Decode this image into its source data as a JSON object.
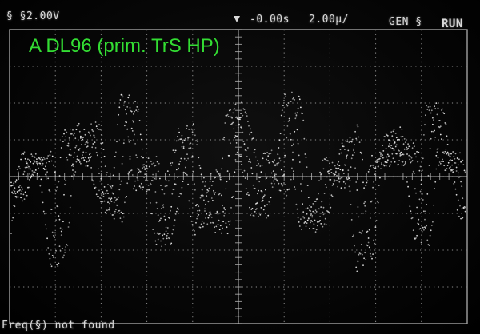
{
  "scope": {
    "channel_scale": "§ §2.00V",
    "timebase_offset": "-0.00s",
    "timebase_div": "2.00µ/",
    "generator_label": "GEN §",
    "run_state": "RUN",
    "measurement": "Freq(§)  not found",
    "overlay_title": "A DL96 (prim. TrS HP)"
  },
  "colors": {
    "trace": "#e8e8e8",
    "grid": "#bdbdbd",
    "overlay_text": "#33dd33",
    "status_text": "#d8d8d8"
  },
  "icons": {
    "trigger_marker": "trigger-arrow-icon",
    "generator_symbol": "generator-icon"
  },
  "grid": {
    "horizontal_divisions": 10,
    "vertical_divisions": 8
  }
}
